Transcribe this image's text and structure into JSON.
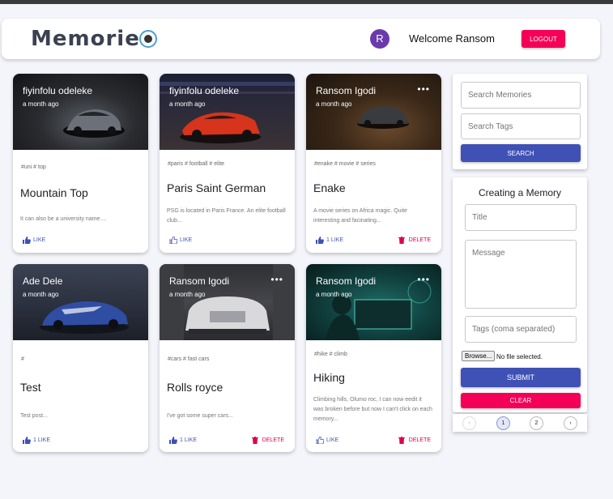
{
  "header": {
    "brand": "Memories",
    "avatar_letter": "R",
    "welcome": "Welcome Ransom",
    "logout_label": "LOGOUT"
  },
  "posts": [
    {
      "author": "fiyinfolu odeleke",
      "time": "a month ago",
      "tags": "#uni # top",
      "title": "Mountain Top",
      "message": "It can also be a university name....",
      "like_label": "LIKE",
      "delete_label": ""
    },
    {
      "author": "fiyinfolu odeleke",
      "time": "a month ago",
      "tags": "#paris # football # elite",
      "title": "Paris Saint German",
      "message": "PSG is located in Paris France. An elite football club...",
      "like_label": "LIKE",
      "delete_label": ""
    },
    {
      "author": "Ransom Igodi",
      "time": "a month ago",
      "tags": "#enake # movie # series",
      "title": "Enake",
      "message": "A movie series on Africa magic. Quite interesting and facinating...",
      "like_label": "1 LIKE",
      "delete_label": "DELETE"
    },
    {
      "author": "Ade Dele",
      "time": "a month ago",
      "tags": "#",
      "title": "Test",
      "message": "Test post...",
      "like_label": "1 LIKE",
      "delete_label": ""
    },
    {
      "author": "Ransom Igodi",
      "time": "a month ago",
      "tags": "#cars # fast cars",
      "title": "Rolls royce",
      "message": "I've got some super cars...",
      "like_label": "1 LIKE",
      "delete_label": "DELETE"
    },
    {
      "author": "Ransom Igodi",
      "time": "a month ago",
      "tags": "#hike # climb",
      "title": "Hiking",
      "message": "Climbing hills, Olumo roc, I can now eedit it was broken before but now I can't click on each memory...",
      "like_label": "LIKE",
      "delete_label": "DELETE"
    }
  ],
  "search": {
    "memories_placeholder": "Search Memories",
    "tags_placeholder": "Search Tags",
    "button": "SEARCH"
  },
  "form": {
    "title": "Creating a Memory",
    "title_placeholder": "Title",
    "message_placeholder": "Message",
    "tags_placeholder": "Tags (coma separated)",
    "browse_label": "Browse...",
    "no_file": "No file selected.",
    "submit": "SUBMIT",
    "clear": "CLEAR"
  },
  "pagination": {
    "prev": "‹",
    "pages": [
      "1",
      "2"
    ],
    "next": "›",
    "current": "1"
  },
  "colors": {
    "primary": "#3f51b5",
    "secondary": "#f50057",
    "avatar": "#6a3aab"
  }
}
